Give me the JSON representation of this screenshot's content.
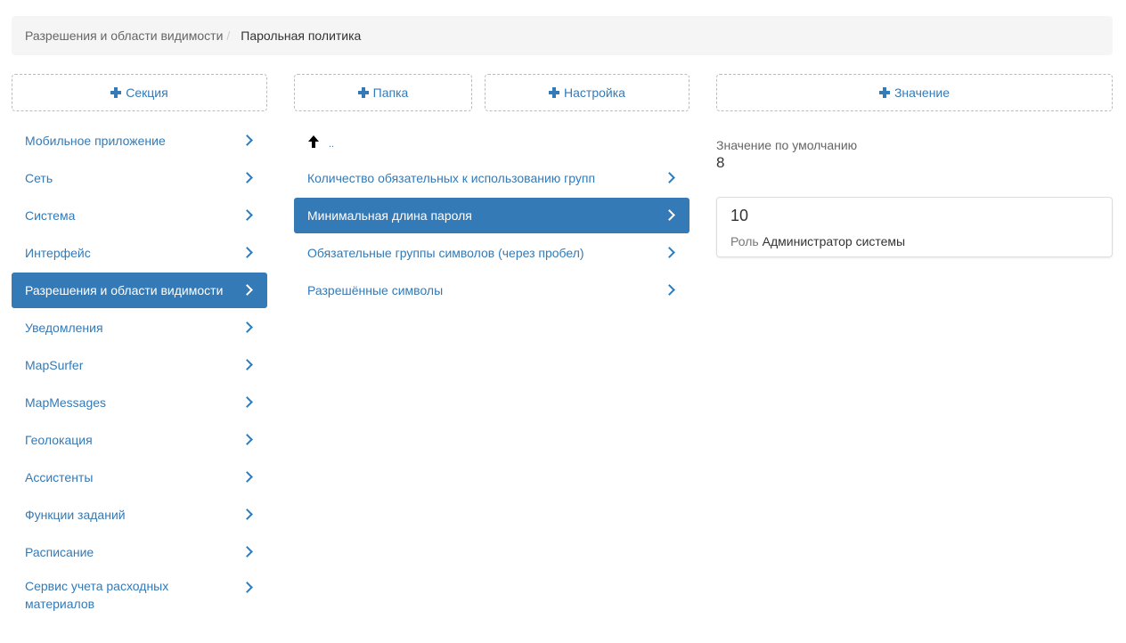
{
  "breadcrumb": {
    "parent": "Разрешения и области видимости",
    "separator": "/",
    "current": "Парольная политика"
  },
  "buttons": {
    "section": "Секция",
    "folder": "Папка",
    "setting": "Настройка",
    "value": "Значение"
  },
  "sections": [
    {
      "label": "Мобильное приложение",
      "active": false
    },
    {
      "label": "Сеть",
      "active": false
    },
    {
      "label": "Система",
      "active": false
    },
    {
      "label": "Интерфейс",
      "active": false
    },
    {
      "label": "Разрешения и области видимости",
      "active": true
    },
    {
      "label": "Уведомления",
      "active": false
    },
    {
      "label": "MapSurfer",
      "active": false
    },
    {
      "label": "MapMessages",
      "active": false
    },
    {
      "label": "Геолокация",
      "active": false
    },
    {
      "label": "Ассистенты",
      "active": false
    },
    {
      "label": "Функции заданий",
      "active": false
    },
    {
      "label": "Расписание",
      "active": false
    },
    {
      "label": "Сервис учета расходных материалов",
      "active": false
    }
  ],
  "folder_up": "..",
  "settings": [
    {
      "label": "Количество обязательных к использованию групп",
      "active": false
    },
    {
      "label": "Минимальная длина пароля",
      "active": true
    },
    {
      "label": "Обязательные группы символов (через пробел)",
      "active": false
    },
    {
      "label": "Разрешённые символы",
      "active": false
    }
  ],
  "default_value": {
    "label": "Значение по умолчанию",
    "value": "8"
  },
  "value_card": {
    "value": "10",
    "role_label": "Роль",
    "role_name": "Администратор системы"
  },
  "colors": {
    "accent": "#337ab7",
    "breadcrumb_bg": "#f5f5f5"
  },
  "icons": {
    "add": "plus-icon",
    "chevron": "chevron-right-icon",
    "up": "arrow-up-icon"
  }
}
